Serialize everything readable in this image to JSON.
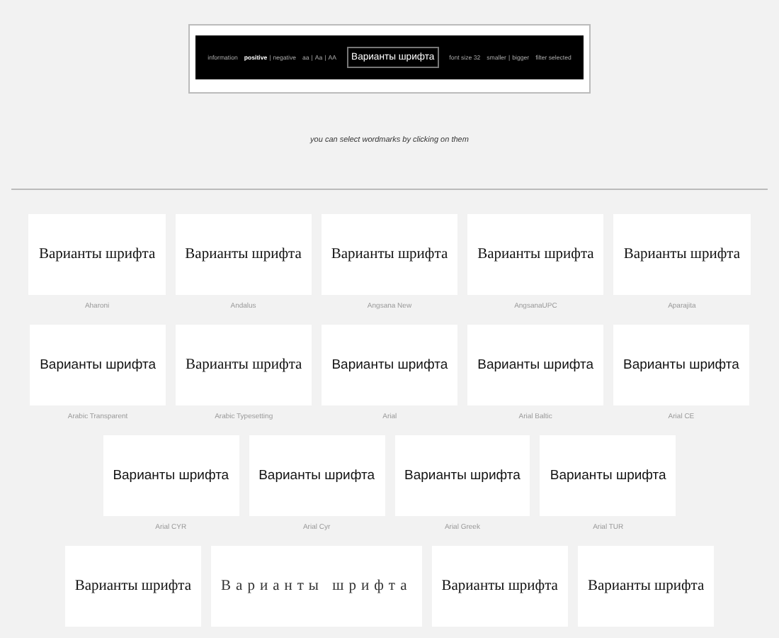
{
  "toolbar": [
    {
      "kind": "link",
      "text": "information",
      "selected": false
    },
    {
      "kind": "link",
      "text": "positive",
      "selected": true
    },
    {
      "kind": "separator",
      "text": "|"
    },
    {
      "kind": "link",
      "text": "negative",
      "selected": false
    },
    {
      "kind": "link",
      "text": "aa",
      "selected": false
    },
    {
      "kind": "separator",
      "text": "|"
    },
    {
      "kind": "link",
      "text": "Aa",
      "selected": false
    },
    {
      "kind": "separator",
      "text": "|"
    },
    {
      "kind": "link",
      "text": "AA",
      "selected": false
    },
    {
      "kind": "preview",
      "text": "Варианты шрифта"
    },
    {
      "kind": "link",
      "text": "font size 32",
      "selected": false
    },
    {
      "kind": "link",
      "text": "smaller",
      "selected": false
    },
    {
      "kind": "separator",
      "text": "|"
    },
    {
      "kind": "link",
      "text": "bigger",
      "selected": false
    },
    {
      "kind": "link",
      "text": "filter selected",
      "selected": false
    }
  ],
  "hint": "you can select wordmarks by clicking on them",
  "rows": [
    [
      {
        "sample": "Варианты шрифта",
        "kind": "serif",
        "name": "Aharoni"
      },
      {
        "sample": "Варианты шрифта",
        "kind": "serif",
        "name": "Andalus"
      },
      {
        "sample": "Варианты шрифта",
        "kind": "serif",
        "name": "Angsana New"
      },
      {
        "sample": "Варианты шрифта",
        "kind": "serif",
        "name": "AngsanaUPC"
      },
      {
        "sample": "Варианты шрифта",
        "kind": "serif",
        "name": "Aparajita"
      }
    ],
    [
      {
        "sample": "Варианты шрифта",
        "kind": "sans",
        "name": "Arabic Transparent"
      },
      {
        "sample": "Варианты шрифта",
        "kind": "serif",
        "name": "Arabic Typesetting"
      },
      {
        "sample": "Варианты шрифта",
        "kind": "sans",
        "name": "Arial"
      },
      {
        "sample": "Варианты шрифта",
        "kind": "sans",
        "name": "Arial Baltic"
      },
      {
        "sample": "Варианты шрифта",
        "kind": "sans",
        "name": "Arial CE"
      }
    ],
    [
      {
        "sample": "Варианты шрифта",
        "kind": "sans",
        "name": "Arial CYR"
      },
      {
        "sample": "Варианты шрифта",
        "kind": "sans",
        "name": "Arial Cyr"
      },
      {
        "sample": "Варианты шрифта",
        "kind": "sans",
        "name": "Arial Greek"
      },
      {
        "sample": "Варианты шрифта",
        "kind": "sans",
        "name": "Arial TUR"
      }
    ],
    [
      {
        "sample": "Варианты шрифта",
        "kind": "serif"
      },
      {
        "sample": "Варианты шрифта",
        "kind": "spaced"
      },
      {
        "sample": "Варианты шрифта",
        "kind": "serif"
      },
      {
        "sample": "Варианты шрифта",
        "kind": "serif"
      }
    ]
  ]
}
